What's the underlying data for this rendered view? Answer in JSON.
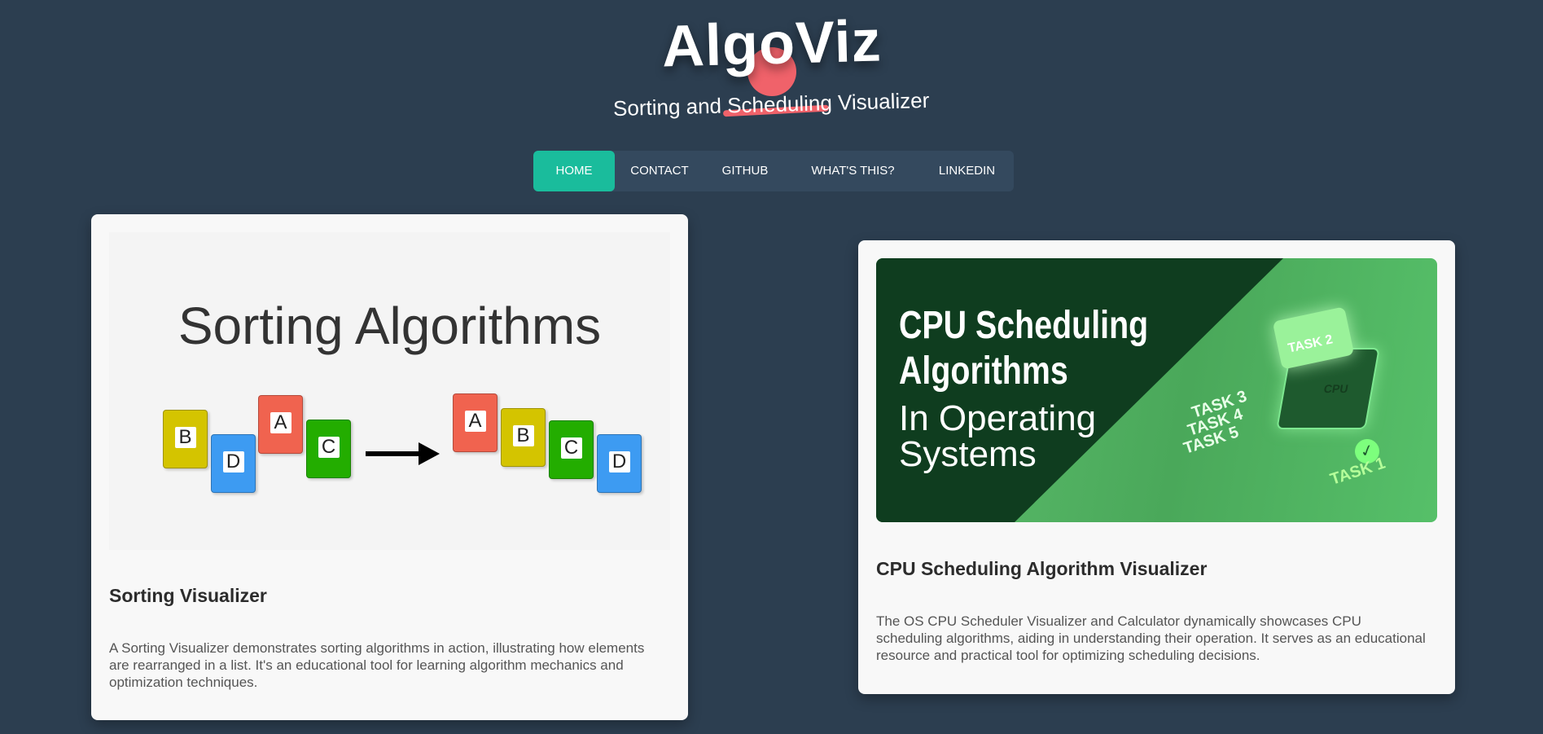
{
  "header": {
    "title": "AlgoViz",
    "subtitle": "Sorting and Scheduling Visualizer"
  },
  "nav": {
    "items": [
      {
        "label": "HOME",
        "active": true
      },
      {
        "label": "CONTACT",
        "active": false
      },
      {
        "label": "GITHUB",
        "active": false
      },
      {
        "label": "WHAT'S THIS?",
        "active": false
      },
      {
        "label": "LINKEDIN",
        "active": false
      }
    ]
  },
  "colors": {
    "background": "#2c3e50",
    "nav_bg": "#34495e",
    "nav_active": "#1abc9c",
    "accent": "#f0626a"
  },
  "cards": [
    {
      "image": {
        "heading": "Sorting Algorithms",
        "before": [
          {
            "letter": "B",
            "color": "#d4c400"
          },
          {
            "letter": "D",
            "color": "#3d9bf2"
          },
          {
            "letter": "A",
            "color": "#f0634f"
          },
          {
            "letter": "C",
            "color": "#23ad00"
          }
        ],
        "after": [
          {
            "letter": "A",
            "color": "#f0634f"
          },
          {
            "letter": "B",
            "color": "#d4c400"
          },
          {
            "letter": "C",
            "color": "#23ad00"
          },
          {
            "letter": "D",
            "color": "#3d9bf2"
          }
        ]
      },
      "title": "Sorting Visualizer",
      "description": "A Sorting Visualizer demonstrates sorting algorithms in action, illustrating how elements are rearranged in a list. It's an educational tool for learning algorithm mechanics and optimization techniques."
    },
    {
      "image": {
        "heading": "CPU Scheduling Algorithms",
        "subheading": "In Operating Systems",
        "tasks": [
          "TASK 2",
          "TASK 3",
          "TASK 4",
          "TASK 5",
          "TASK 1"
        ],
        "chip_label": "CPU"
      },
      "title": "CPU Scheduling Algorithm Visualizer",
      "description": "The OS CPU Scheduler Visualizer and Calculator dynamically showcases CPU scheduling algorithms, aiding in understanding their operation. It serves as an educational resource and practical tool for optimizing scheduling decisions."
    }
  ]
}
